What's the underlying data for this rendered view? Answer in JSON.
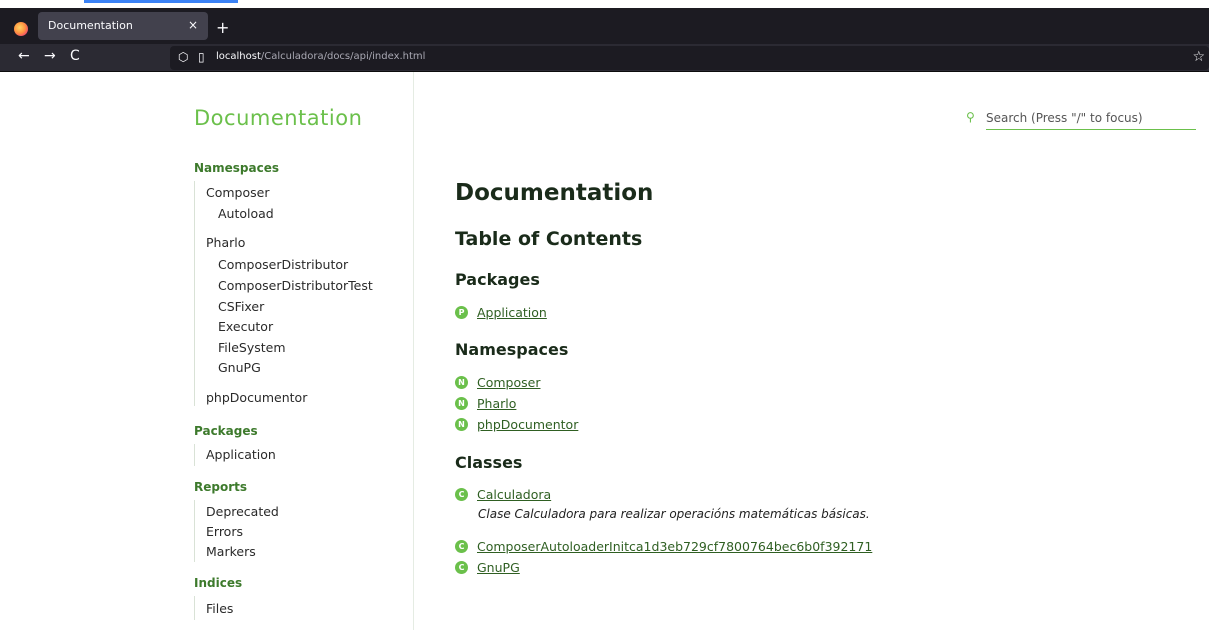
{
  "browser": {
    "tab_title": "Documentation",
    "tab_close": "×",
    "new_tab": "+",
    "back": "←",
    "forward": "→",
    "reload": "C",
    "url_host": "localhost",
    "url_path": "/Calculadora/docs/api/index.html",
    "star": "☆"
  },
  "sidebar": {
    "title": "Documentation",
    "namespaces_label": "Namespaces",
    "namespaces": {
      "composer": "Composer",
      "autoload": "Autoload",
      "pharlo": "Pharlo",
      "composer_distributor": "ComposerDistributor",
      "composer_distributor_test": "ComposerDistributorTest",
      "csfixer": "CSFixer",
      "executor": "Executor",
      "filesystem": "FileSystem",
      "gnupg": "GnuPG",
      "phpdocumentor": "phpDocumentor"
    },
    "packages_label": "Packages",
    "packages": {
      "application": "Application"
    },
    "reports_label": "Reports",
    "reports": {
      "deprecated": "Deprecated",
      "errors": "Errors",
      "markers": "Markers"
    },
    "indices_label": "Indices",
    "indices": {
      "files": "Files"
    }
  },
  "search": {
    "placeholder": "Search (Press \"/\" to focus)"
  },
  "main": {
    "title": "Documentation",
    "toc_title": "Table of Contents",
    "packages_heading": "Packages",
    "packages": [
      {
        "badge": "P",
        "label": "Application"
      }
    ],
    "namespaces_heading": "Namespaces",
    "namespaces": [
      {
        "badge": "N",
        "label": "Composer"
      },
      {
        "badge": "N",
        "label": "Pharlo"
      },
      {
        "badge": "N",
        "label": "phpDocumentor"
      }
    ],
    "classes_heading": "Classes",
    "classes": [
      {
        "badge": "C",
        "label": "Calculadora",
        "description": "Clase Calculadora para realizar operacións matemáticas básicas."
      },
      {
        "badge": "C",
        "label": "ComposerAutoloaderInitca1d3eb729cf7800764bec6b0f392171"
      },
      {
        "badge": "C",
        "label": "GnuPG"
      }
    ]
  },
  "colors": {
    "accent": "#6bc04b",
    "heading_green": "#3d7a2c",
    "link": "#2f5f22"
  }
}
